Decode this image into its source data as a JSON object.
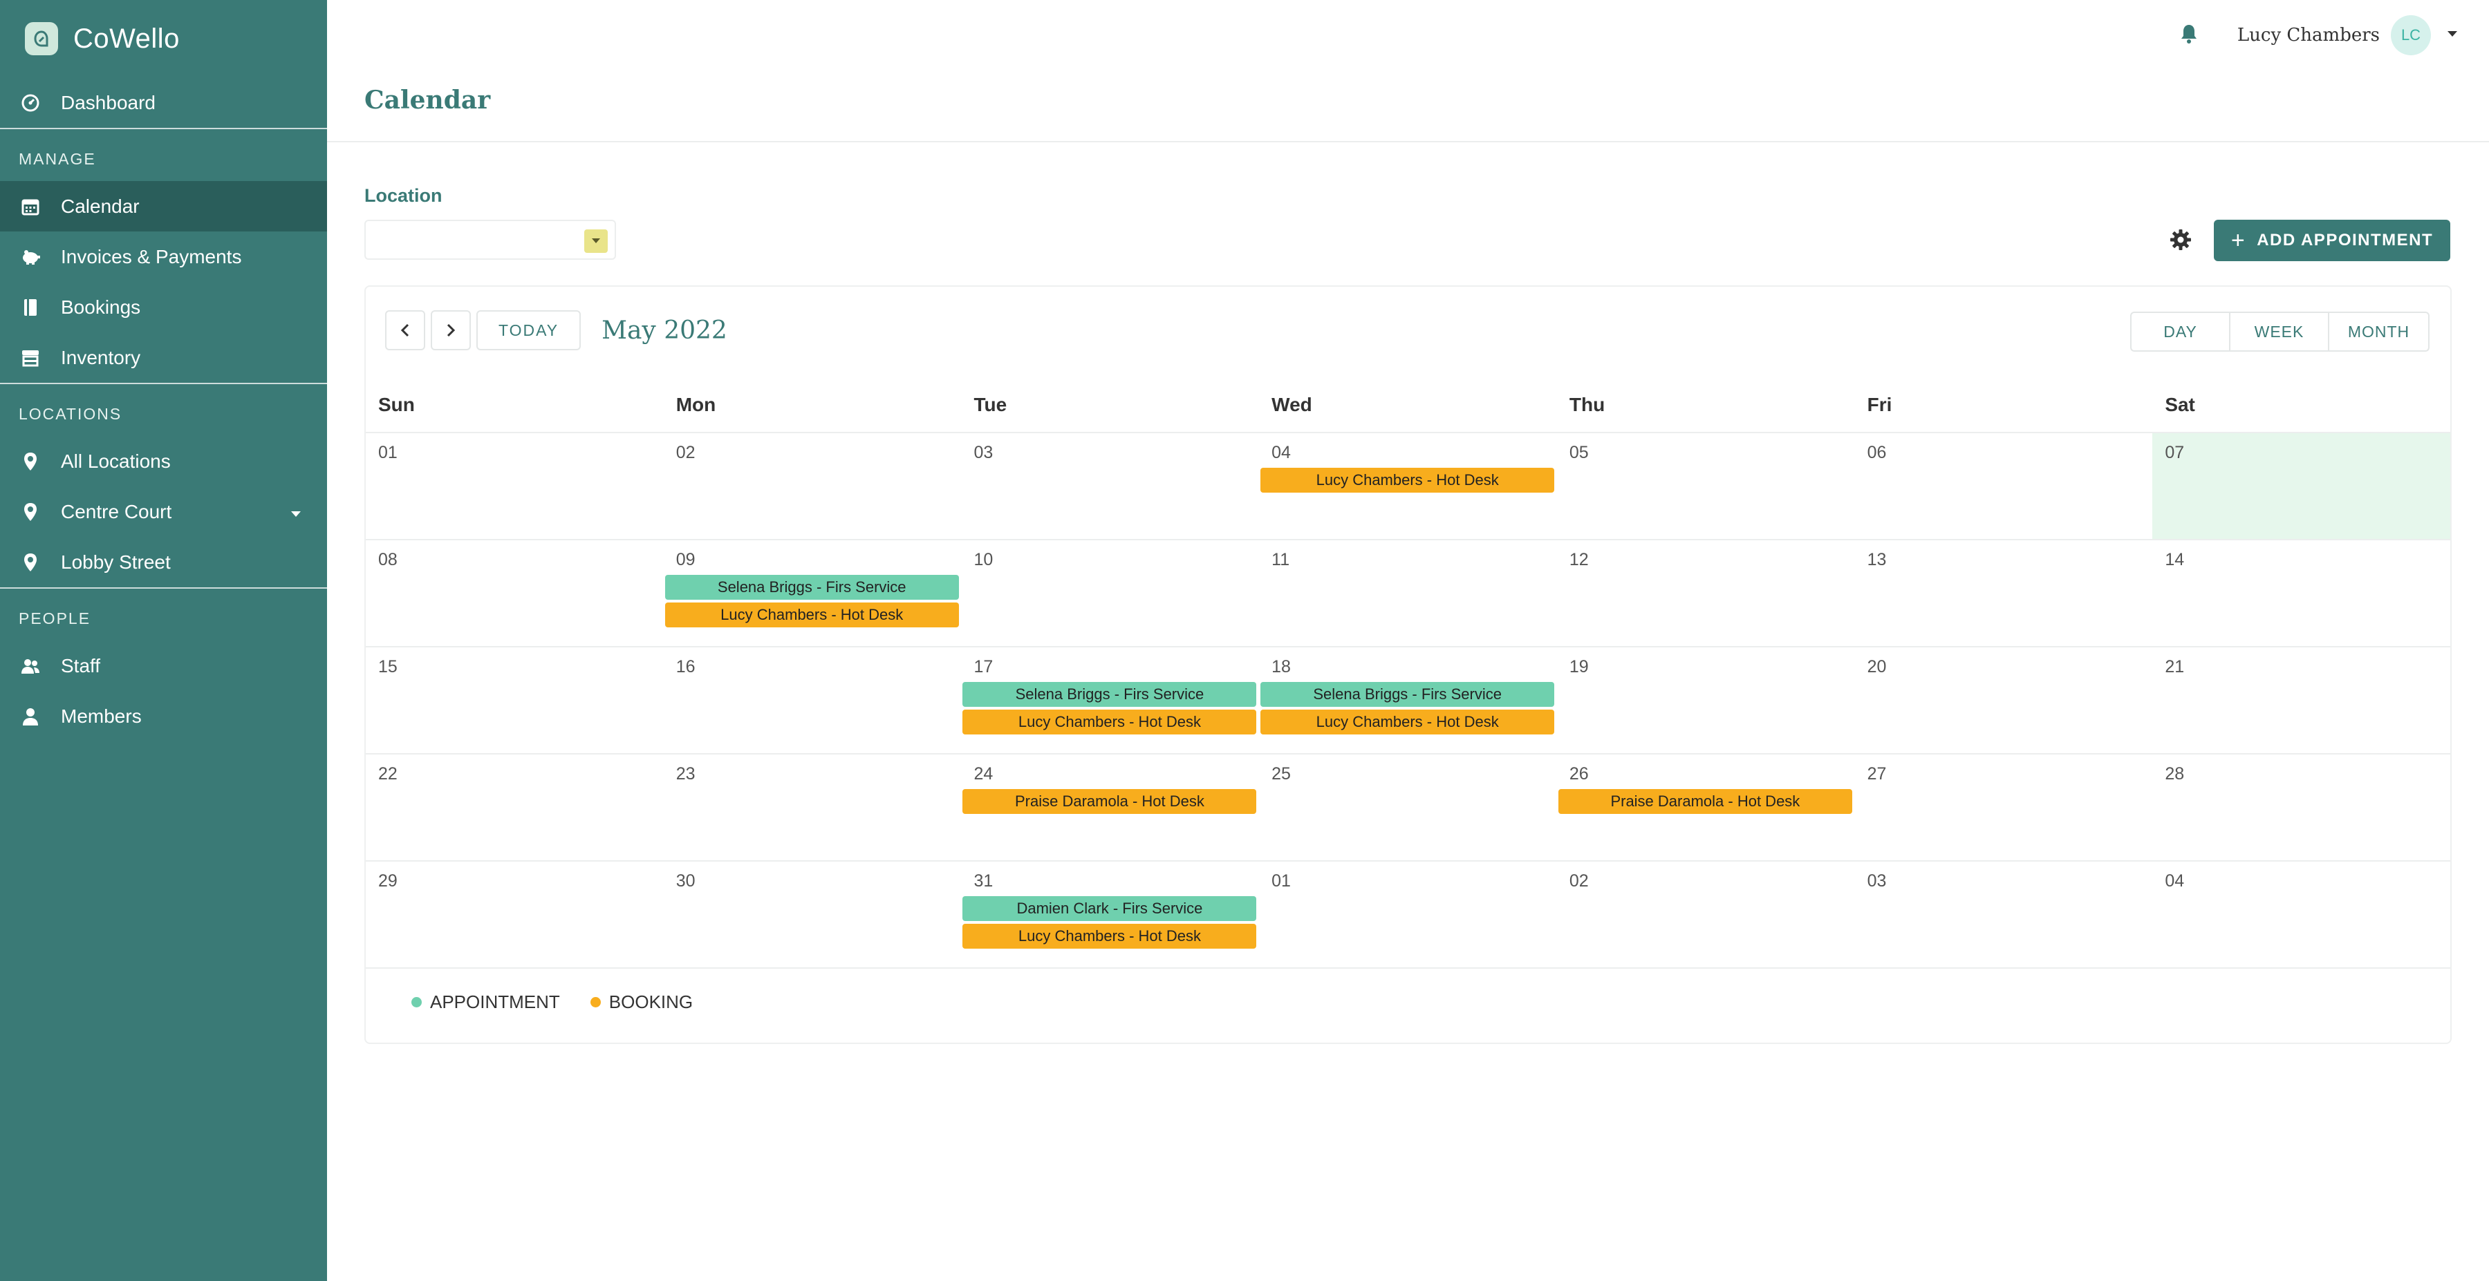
{
  "app": {
    "name": "CoWello"
  },
  "sidebar": {
    "dashboard": "Dashboard",
    "sections": {
      "manage": "MANAGE",
      "locations": "LOCATIONS",
      "people": "PEOPLE"
    },
    "manage_items": [
      "Calendar",
      "Invoices & Payments",
      "Bookings",
      "Inventory"
    ],
    "location_items": [
      "All Locations",
      "Centre Court",
      "Lobby Street"
    ],
    "people_items": [
      "Staff",
      "Members"
    ]
  },
  "header": {
    "title": "Calendar",
    "user_name": "Lucy Chambers",
    "user_initials": "LC"
  },
  "filters": {
    "location_label": "Location",
    "location_value": ""
  },
  "actions": {
    "add_appointment": "ADD APPOINTMENT"
  },
  "calendar": {
    "today_label": "TODAY",
    "month_title": "May 2022",
    "views": [
      "DAY",
      "WEEK",
      "MONTH"
    ],
    "weekdays": [
      "Sun",
      "Mon",
      "Tue",
      "Wed",
      "Thu",
      "Fri",
      "Sat"
    ],
    "weeks": [
      [
        "01",
        "02",
        "03",
        "04",
        "05",
        "06",
        "07"
      ],
      [
        "08",
        "09",
        "10",
        "11",
        "12",
        "13",
        "14"
      ],
      [
        "15",
        "16",
        "17",
        "18",
        "19",
        "20",
        "21"
      ],
      [
        "22",
        "23",
        "24",
        "25",
        "26",
        "27",
        "28"
      ],
      [
        "29",
        "30",
        "31",
        "01",
        "02",
        "03",
        "04"
      ]
    ],
    "events": {
      "w0_wed_1": "Lucy Chambers - Hot Desk",
      "w1_mon_1": "Selena Briggs - Firs Service",
      "w1_mon_2": "Lucy Chambers - Hot Desk",
      "w2_tue_1": "Selena Briggs - Firs Service",
      "w2_tue_2": "Lucy Chambers - Hot Desk",
      "w2_wed_1": "Selena Briggs - Firs Service",
      "w2_wed_2": "Lucy Chambers - Hot Desk",
      "w3_tue_1": "Praise Daramola - Hot Desk",
      "w3_thu_1": "Praise Daramola - Hot Desk",
      "w4_tue_1": "Damien Clark - Firs Service",
      "w4_tue_2": "Lucy Chambers - Hot Desk"
    },
    "legend": {
      "appointment": "APPOINTMENT",
      "booking": "BOOKING"
    }
  },
  "colors": {
    "sidebar": "#3a7a76",
    "sidebar_active": "#2a5e5b",
    "appointment": "#6fd0ae",
    "booking": "#f8ad1d",
    "highlight_day": "#e6f7ec"
  }
}
